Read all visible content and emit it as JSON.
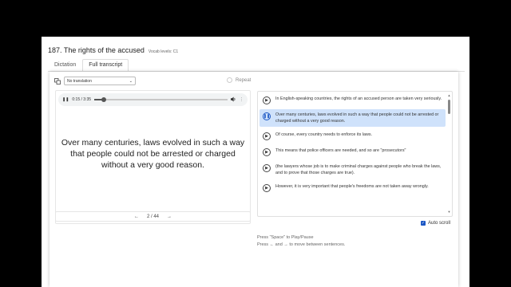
{
  "header": {
    "title": "187. The rights of the accused",
    "vocab_level": "Vocab levels: C1"
  },
  "tabs": [
    {
      "label": "Dictation"
    },
    {
      "label": "Full transcript"
    }
  ],
  "toolbar": {
    "translation_select": "No translation",
    "repeat_label": "Repeat"
  },
  "audio": {
    "time": "0:15 / 3:35",
    "progress": 0.07
  },
  "current_sentence": "Over many centuries, laws evolved in such a way that people could not be arrested or charged without a very good reason.",
  "pager": {
    "prev": "←",
    "position": "2 / 44",
    "next": "→"
  },
  "transcript": [
    {
      "text": "In English-speaking countries, the rights of an accused person are taken very seriously.",
      "active": false
    },
    {
      "text": "Over many centuries, laws evolved in such a way that people could not be arrested or charged without a very good reason.",
      "active": true
    },
    {
      "text": "Of course, every country needs to enforce its laws.",
      "active": false
    },
    {
      "text": "This means that police officers are needed, and so are \"prosecutors\"",
      "active": false
    },
    {
      "text": "(the lawyers whose job is to make criminal charges against people who break the laws, and to prove that those charges are true).",
      "active": false
    },
    {
      "text": "However, it is very important that people's freedoms are not taken away wrongly.",
      "active": false
    }
  ],
  "auto_scroll": {
    "label": "Auto scroll",
    "checked": true
  },
  "hints": [
    "Press \"Space\" to Play/Pause",
    "Press ← and → to move between sentences."
  ],
  "colors": {
    "accent": "#1a56c4",
    "active_row": "#cfe2fb"
  }
}
